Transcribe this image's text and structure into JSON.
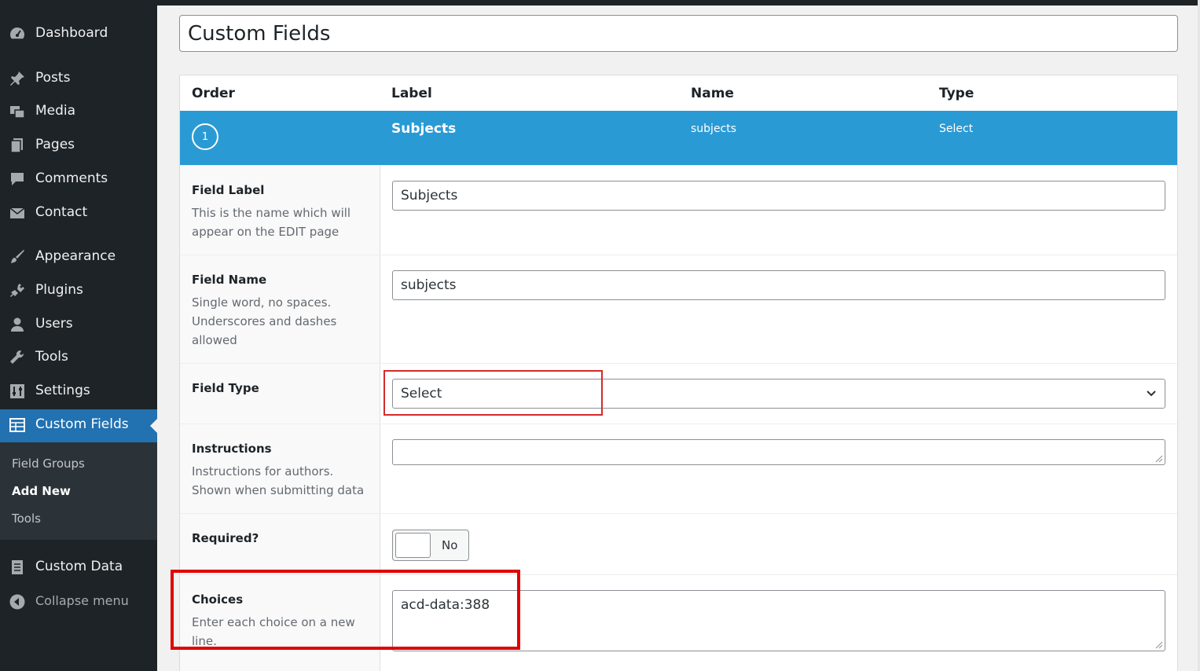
{
  "sidebar": {
    "items": [
      {
        "label": "Dashboard",
        "icon": "dashboard-icon"
      },
      {
        "label": "Posts",
        "icon": "pin-icon"
      },
      {
        "label": "Media",
        "icon": "media-icon"
      },
      {
        "label": "Pages",
        "icon": "pages-icon"
      },
      {
        "label": "Comments",
        "icon": "comment-icon"
      },
      {
        "label": "Contact",
        "icon": "envelope-icon"
      },
      {
        "label": "Appearance",
        "icon": "brush-icon"
      },
      {
        "label": "Plugins",
        "icon": "plug-icon"
      },
      {
        "label": "Users",
        "icon": "user-icon"
      },
      {
        "label": "Tools",
        "icon": "wrench-icon"
      },
      {
        "label": "Settings",
        "icon": "settings-icon"
      },
      {
        "label": "Custom Fields",
        "icon": "table-icon"
      },
      {
        "label": "Custom Data",
        "icon": "document-icon"
      }
    ],
    "submenu": [
      "Field Groups",
      "Add New",
      "Tools"
    ],
    "collapse_label": "Collapse menu"
  },
  "title": "Custom Fields",
  "table_header": {
    "order": "Order",
    "label": "Label",
    "name": "Name",
    "type": "Type"
  },
  "field": {
    "order": "1",
    "label": "Subjects",
    "name": "subjects",
    "type": "Select"
  },
  "settings": {
    "field_label": {
      "name": "Field Label",
      "desc": "This is the name which will appear on the EDIT page",
      "value": "Subjects"
    },
    "field_name": {
      "name": "Field Name",
      "desc": "Single word, no spaces. Underscores and dashes allowed",
      "value": "subjects"
    },
    "field_type": {
      "name": "Field Type",
      "value": "Select"
    },
    "instructions": {
      "name": "Instructions",
      "desc": "Instructions for authors. Shown when submitting data",
      "value": ""
    },
    "required": {
      "name": "Required?",
      "toggle_label": "No"
    },
    "choices": {
      "name": "Choices",
      "desc": "Enter each choice on a new line.",
      "value": "acd-data:388"
    }
  },
  "colors": {
    "sidebar_bg": "#1d2327",
    "active_menu": "#2271b1",
    "field_row": "#2a9ad4",
    "highlight": "#e00000"
  }
}
